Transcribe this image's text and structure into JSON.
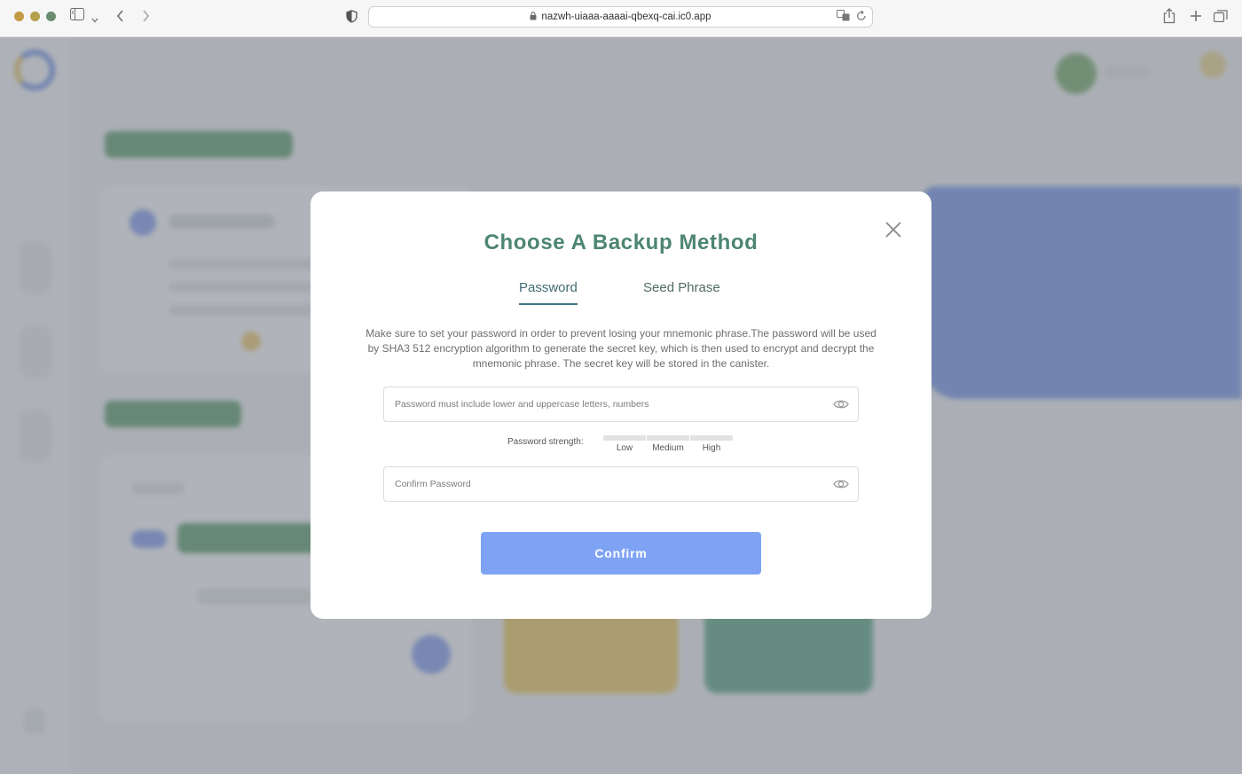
{
  "browser": {
    "url": "nazwh-uiaaa-aaaai-qbexq-cai.ic0.app"
  },
  "modal": {
    "title": "Choose A Backup Method",
    "tabs": [
      {
        "label": "Password",
        "active": true
      },
      {
        "label": "Seed Phrase",
        "active": false
      }
    ],
    "description": "Make sure to set your password in order to prevent losing your mnemonic phrase.The password will be used by SHA3 512 encryption algorithm to generate the secret key, which is then used to encrypt and decrypt the mnemonic phrase. The secret key will be stored in the canister.",
    "password_field": {
      "placeholder": "Password must include lower and uppercase letters, numbers",
      "value": ""
    },
    "strength": {
      "label": "Password strength:",
      "levels": [
        "Low",
        "Medium",
        "High"
      ]
    },
    "confirm_field": {
      "placeholder": "Confirm Password",
      "value": ""
    },
    "confirm_label": "Confirm"
  },
  "icons": {
    "close": "close-icon",
    "eye": "eye-icon",
    "lock": "lock-icon",
    "sidebar": "sidebar-icon",
    "back": "chevron-left-icon",
    "forward": "chevron-right-icon",
    "share": "share-icon",
    "new_tab": "plus-icon",
    "tabs": "tabs-overview-icon",
    "shield": "shield-icon",
    "translate": "translate-icon",
    "reload": "reload-icon"
  },
  "colors": {
    "title_green": "#4d8670",
    "tab_active": "#3f7383",
    "button_blue": "#7fa3f4"
  }
}
